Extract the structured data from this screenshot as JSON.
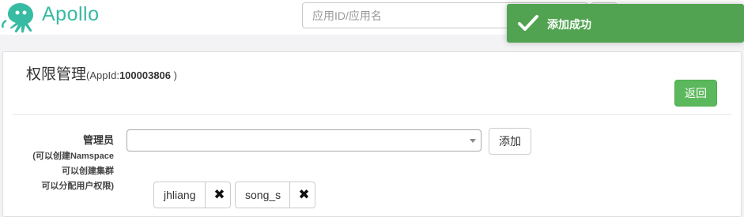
{
  "navbar": {
    "brand": "Apollo",
    "search_placeholder": "应用ID/应用名"
  },
  "toast": {
    "message": "添加成功",
    "icon": "checkmark-icon",
    "color": "#51a351"
  },
  "panel": {
    "title": "权限管理",
    "appid_prefix": "(AppId:",
    "appid_value": "100003806",
    "appid_suffix": " )",
    "back_label": "返回"
  },
  "admin": {
    "label": "管理员",
    "hint_lines": [
      "(可以创建Namspace",
      "可以创建集群",
      "可以分配用户权限)"
    ],
    "select_value": "",
    "add_label": "添加",
    "users": [
      {
        "name": "jhliang",
        "remove_icon": "close-icon"
      },
      {
        "name": "song_s",
        "remove_icon": "close-icon"
      }
    ]
  },
  "colors": {
    "brand": "#38bba3",
    "success": "#5cb85c"
  }
}
